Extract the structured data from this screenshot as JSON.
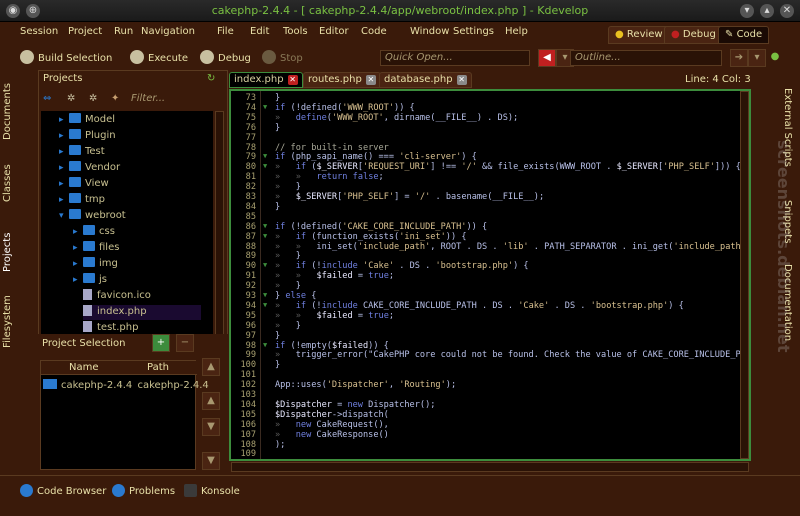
{
  "window": {
    "title": "cakephp-2.4.4 - [ cakephp-2.4.4/app/webroot/index.php ] - Kdevelop"
  },
  "menu": [
    "Session",
    "Project",
    "Run",
    "Navigation",
    "File",
    "Edit",
    "Tools",
    "Editor",
    "Code",
    "Window",
    "Settings",
    "Help"
  ],
  "toolbar": {
    "build": "Build Selection",
    "execute": "Execute",
    "debug": "Debug",
    "stop": "Stop",
    "quick_open": "Quick Open...",
    "outline": "Outline..."
  },
  "areas": {
    "review": "Review",
    "debug": "Debug",
    "code": "Code"
  },
  "left_tabs": [
    "Documents",
    "Classes",
    "Projects",
    "Filesystem"
  ],
  "right_tabs": [
    "External Scripts",
    "Snippets",
    "Documentation"
  ],
  "projects": {
    "title": "Projects",
    "filter_placeholder": "Filter...",
    "tree": [
      {
        "name": "Model",
        "type": "folder"
      },
      {
        "name": "Plugin",
        "type": "folder"
      },
      {
        "name": "Test",
        "type": "folder"
      },
      {
        "name": "Vendor",
        "type": "folder"
      },
      {
        "name": "View",
        "type": "folder"
      },
      {
        "name": "tmp",
        "type": "folder"
      },
      {
        "name": "webroot",
        "type": "folder-open"
      },
      {
        "name": "css",
        "type": "folder"
      },
      {
        "name": "files",
        "type": "folder"
      },
      {
        "name": "img",
        "type": "folder"
      },
      {
        "name": "js",
        "type": "folder"
      },
      {
        "name": "favicon.ico",
        "type": "file"
      },
      {
        "name": "index.php",
        "type": "file"
      },
      {
        "name": "test.php",
        "type": "file"
      }
    ]
  },
  "selection": {
    "title": "Project Selection",
    "col_name": "Name",
    "col_path": "Path",
    "row_name": "cakephp-2.4.4",
    "row_path": "cakephp-2.4.4"
  },
  "editor_tabs": [
    "index.php",
    "routes.php",
    "database.php"
  ],
  "position": "Line: 4 Col: 3",
  "code": [
    {
      "n": "73",
      "t": "}"
    },
    {
      "n": "74",
      "t": "if (!defined('WWW_ROOT')) {"
    },
    {
      "n": "75",
      "t": "»   define('WWW_ROOT', dirname(__FILE__) . DS);"
    },
    {
      "n": "76",
      "t": "}"
    },
    {
      "n": "77",
      "t": ""
    },
    {
      "n": "78",
      "t": "// for built-in server"
    },
    {
      "n": "79",
      "t": "if (php_sapi_name() === 'cli-server') {"
    },
    {
      "n": "80",
      "t": "»   if ($_SERVER['REQUEST_URI'] !== '/' && file_exists(WWW_ROOT . $_SERVER['PHP_SELF'])) {"
    },
    {
      "n": "81",
      "t": "»   »   return false;"
    },
    {
      "n": "82",
      "t": "»   }"
    },
    {
      "n": "83",
      "t": "»   $_SERVER['PHP_SELF'] = '/' . basename(__FILE__);"
    },
    {
      "n": "84",
      "t": "}"
    },
    {
      "n": "85",
      "t": ""
    },
    {
      "n": "86",
      "t": "if (!defined('CAKE_CORE_INCLUDE_PATH')) {"
    },
    {
      "n": "87",
      "t": "»   if (function_exists('ini_set')) {"
    },
    {
      "n": "88",
      "t": "»   »   ini_set('include_path', ROOT . DS . 'lib' . PATH_SEPARATOR . ini_get('include_path'));"
    },
    {
      "n": "89",
      "t": "»   }"
    },
    {
      "n": "90",
      "t": "»   if (!include 'Cake' . DS . 'bootstrap.php') {"
    },
    {
      "n": "91",
      "t": "»   »   $failed = true;"
    },
    {
      "n": "92",
      "t": "»   }"
    },
    {
      "n": "93",
      "t": "} else {"
    },
    {
      "n": "94",
      "t": "»   if (!include CAKE_CORE_INCLUDE_PATH . DS . 'Cake' . DS . 'bootstrap.php') {"
    },
    {
      "n": "95",
      "t": "»   »   $failed = true;"
    },
    {
      "n": "96",
      "t": "»   }"
    },
    {
      "n": "97",
      "t": "}"
    },
    {
      "n": "98",
      "t": "if (!empty($failed)) {"
    },
    {
      "n": "99",
      "t": "»   trigger_error(\"CakePHP core could not be found. Check the value of CAKE_CORE_INCLUDE_PATH i"
    },
    {
      "n": "100",
      "t": "}"
    },
    {
      "n": "101",
      "t": ""
    },
    {
      "n": "102",
      "t": "App::uses('Dispatcher', 'Routing');"
    },
    {
      "n": "103",
      "t": ""
    },
    {
      "n": "104",
      "t": "$Dispatcher = new Dispatcher();"
    },
    {
      "n": "105",
      "t": "$Dispatcher->dispatch("
    },
    {
      "n": "106",
      "t": "»   new CakeRequest(),"
    },
    {
      "n": "107",
      "t": "»   new CakeResponse()"
    },
    {
      "n": "108",
      "t": ");"
    },
    {
      "n": "109",
      "t": ""
    }
  ],
  "folds": [
    "74",
    "79",
    "80",
    "86",
    "87",
    "90",
    "93",
    "94",
    "98"
  ],
  "status": {
    "code_browser": "Code Browser",
    "problems": "Problems",
    "konsole": "Konsole"
  },
  "watermark": "screenshots.debian.net",
  "colors": {
    "accent_green": "#3c8c3c",
    "folder_blue": "#2a7ad0",
    "background": "#3a1a0a"
  }
}
